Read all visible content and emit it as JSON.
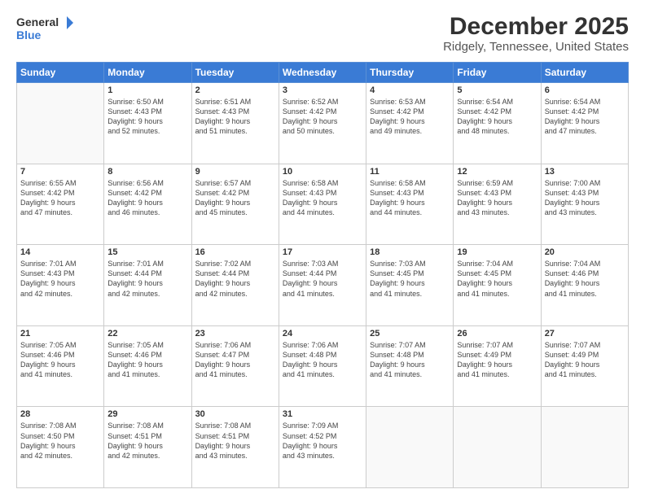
{
  "logo": {
    "line1": "General",
    "line2": "Blue",
    "arrow_color": "#3a7bd5"
  },
  "header": {
    "title": "December 2025",
    "location": "Ridgely, Tennessee, United States"
  },
  "weekdays": [
    "Sunday",
    "Monday",
    "Tuesday",
    "Wednesday",
    "Thursday",
    "Friday",
    "Saturday"
  ],
  "weeks": [
    [
      {
        "day": "",
        "info": ""
      },
      {
        "day": "1",
        "info": "Sunrise: 6:50 AM\nSunset: 4:43 PM\nDaylight: 9 hours\nand 52 minutes."
      },
      {
        "day": "2",
        "info": "Sunrise: 6:51 AM\nSunset: 4:43 PM\nDaylight: 9 hours\nand 51 minutes."
      },
      {
        "day": "3",
        "info": "Sunrise: 6:52 AM\nSunset: 4:42 PM\nDaylight: 9 hours\nand 50 minutes."
      },
      {
        "day": "4",
        "info": "Sunrise: 6:53 AM\nSunset: 4:42 PM\nDaylight: 9 hours\nand 49 minutes."
      },
      {
        "day": "5",
        "info": "Sunrise: 6:54 AM\nSunset: 4:42 PM\nDaylight: 9 hours\nand 48 minutes."
      },
      {
        "day": "6",
        "info": "Sunrise: 6:54 AM\nSunset: 4:42 PM\nDaylight: 9 hours\nand 47 minutes."
      }
    ],
    [
      {
        "day": "7",
        "info": "Sunrise: 6:55 AM\nSunset: 4:42 PM\nDaylight: 9 hours\nand 47 minutes."
      },
      {
        "day": "8",
        "info": "Sunrise: 6:56 AM\nSunset: 4:42 PM\nDaylight: 9 hours\nand 46 minutes."
      },
      {
        "day": "9",
        "info": "Sunrise: 6:57 AM\nSunset: 4:42 PM\nDaylight: 9 hours\nand 45 minutes."
      },
      {
        "day": "10",
        "info": "Sunrise: 6:58 AM\nSunset: 4:43 PM\nDaylight: 9 hours\nand 44 minutes."
      },
      {
        "day": "11",
        "info": "Sunrise: 6:58 AM\nSunset: 4:43 PM\nDaylight: 9 hours\nand 44 minutes."
      },
      {
        "day": "12",
        "info": "Sunrise: 6:59 AM\nSunset: 4:43 PM\nDaylight: 9 hours\nand 43 minutes."
      },
      {
        "day": "13",
        "info": "Sunrise: 7:00 AM\nSunset: 4:43 PM\nDaylight: 9 hours\nand 43 minutes."
      }
    ],
    [
      {
        "day": "14",
        "info": "Sunrise: 7:01 AM\nSunset: 4:43 PM\nDaylight: 9 hours\nand 42 minutes."
      },
      {
        "day": "15",
        "info": "Sunrise: 7:01 AM\nSunset: 4:44 PM\nDaylight: 9 hours\nand 42 minutes."
      },
      {
        "day": "16",
        "info": "Sunrise: 7:02 AM\nSunset: 4:44 PM\nDaylight: 9 hours\nand 42 minutes."
      },
      {
        "day": "17",
        "info": "Sunrise: 7:03 AM\nSunset: 4:44 PM\nDaylight: 9 hours\nand 41 minutes."
      },
      {
        "day": "18",
        "info": "Sunrise: 7:03 AM\nSunset: 4:45 PM\nDaylight: 9 hours\nand 41 minutes."
      },
      {
        "day": "19",
        "info": "Sunrise: 7:04 AM\nSunset: 4:45 PM\nDaylight: 9 hours\nand 41 minutes."
      },
      {
        "day": "20",
        "info": "Sunrise: 7:04 AM\nSunset: 4:46 PM\nDaylight: 9 hours\nand 41 minutes."
      }
    ],
    [
      {
        "day": "21",
        "info": "Sunrise: 7:05 AM\nSunset: 4:46 PM\nDaylight: 9 hours\nand 41 minutes."
      },
      {
        "day": "22",
        "info": "Sunrise: 7:05 AM\nSunset: 4:46 PM\nDaylight: 9 hours\nand 41 minutes."
      },
      {
        "day": "23",
        "info": "Sunrise: 7:06 AM\nSunset: 4:47 PM\nDaylight: 9 hours\nand 41 minutes."
      },
      {
        "day": "24",
        "info": "Sunrise: 7:06 AM\nSunset: 4:48 PM\nDaylight: 9 hours\nand 41 minutes."
      },
      {
        "day": "25",
        "info": "Sunrise: 7:07 AM\nSunset: 4:48 PM\nDaylight: 9 hours\nand 41 minutes."
      },
      {
        "day": "26",
        "info": "Sunrise: 7:07 AM\nSunset: 4:49 PM\nDaylight: 9 hours\nand 41 minutes."
      },
      {
        "day": "27",
        "info": "Sunrise: 7:07 AM\nSunset: 4:49 PM\nDaylight: 9 hours\nand 41 minutes."
      }
    ],
    [
      {
        "day": "28",
        "info": "Sunrise: 7:08 AM\nSunset: 4:50 PM\nDaylight: 9 hours\nand 42 minutes."
      },
      {
        "day": "29",
        "info": "Sunrise: 7:08 AM\nSunset: 4:51 PM\nDaylight: 9 hours\nand 42 minutes."
      },
      {
        "day": "30",
        "info": "Sunrise: 7:08 AM\nSunset: 4:51 PM\nDaylight: 9 hours\nand 43 minutes."
      },
      {
        "day": "31",
        "info": "Sunrise: 7:09 AM\nSunset: 4:52 PM\nDaylight: 9 hours\nand 43 minutes."
      },
      {
        "day": "",
        "info": ""
      },
      {
        "day": "",
        "info": ""
      },
      {
        "day": "",
        "info": ""
      }
    ]
  ]
}
